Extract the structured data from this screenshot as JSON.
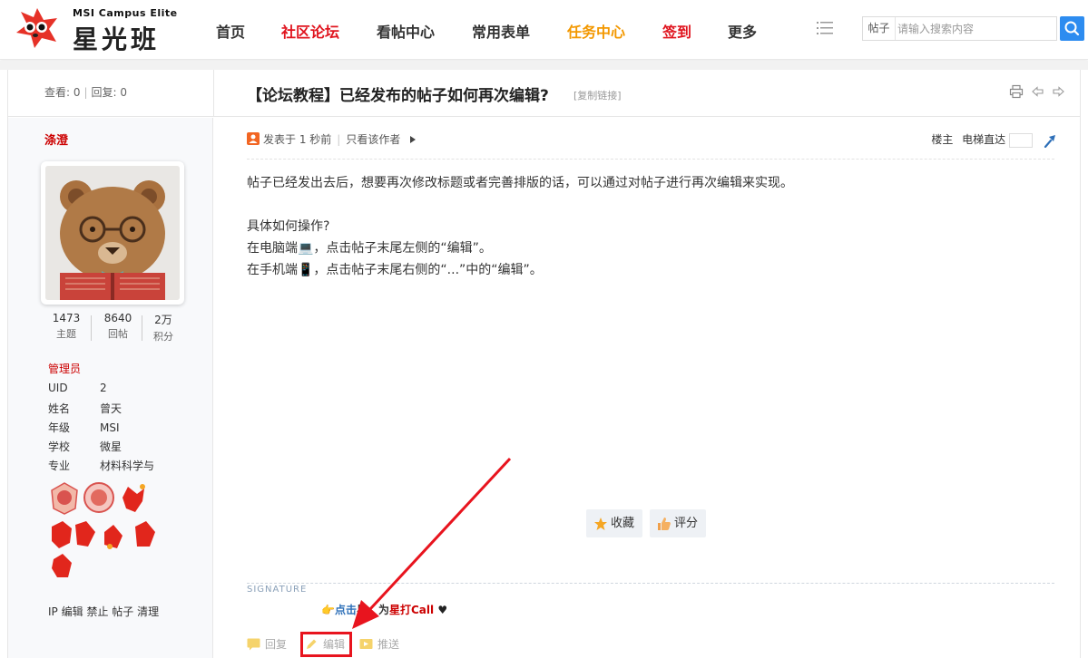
{
  "logo": {
    "small_text": "MSI Campus Elite",
    "big_text": "星光班"
  },
  "nav": {
    "items": [
      {
        "label": "首页",
        "color": "#333333"
      },
      {
        "label": "社区论坛",
        "color": "#e0141e"
      },
      {
        "label": "看帖中心",
        "color": "#333333"
      },
      {
        "label": "常用表单",
        "color": "#333333"
      },
      {
        "label": "任务中心",
        "color": "#f39800"
      },
      {
        "label": "签到",
        "color": "#e0141e"
      },
      {
        "label": "更多",
        "color": "#333333"
      }
    ]
  },
  "search": {
    "type_label": "帖子",
    "placeholder": "请输入搜索内容"
  },
  "thread": {
    "views_label": "查看: 0",
    "replies_label": "回复: 0",
    "title": "【论坛教程】已经发布的帖子如何再次编辑?",
    "copy_link": "[复制链接]"
  },
  "author": {
    "name": "涤澄",
    "stats": [
      {
        "value": "1473",
        "label": "主题"
      },
      {
        "value": "8640",
        "label": "回帖"
      },
      {
        "value": "2万",
        "label": "积分"
      }
    ],
    "role": "管理员",
    "info": [
      {
        "key": "UID",
        "value": "2"
      },
      {
        "key": "姓名",
        "value": "曾天"
      },
      {
        "key": "年级",
        "value": "MSI"
      },
      {
        "key": "学校",
        "value": "微星"
      },
      {
        "key": "专业",
        "value": "材料科学与"
      }
    ],
    "admin_links": [
      "IP",
      "编辑",
      "禁止",
      "帖子",
      "清理"
    ]
  },
  "post": {
    "posted_time": "发表于 1 秒前",
    "only_author": "只看该作者",
    "floor": "楼主",
    "elevator": "电梯直达",
    "body": [
      "帖子已经发出去后，想要再次修改标题或者完善排版的话，可以通过对帖子进行再次编辑来实现。",
      "",
      "具体如何操作?",
      "在电脑端💻，点击帖子末尾左侧的“编辑”。",
      "在手机端📱，点击帖子末尾右侧的“...”中的“编辑”。"
    ],
    "favorite_label": "收藏",
    "rate_label": "评分",
    "signature_label": "SIGNATURE",
    "signature_prefix": "点击",
    "signature_mid": "星，为",
    "signature_star": "星打",
    "signature_call": "Call",
    "reply_label": "回复",
    "edit_label": "编辑",
    "push_label": "推送"
  },
  "colors": {
    "accent_red": "#e0141e",
    "accent_blue": "#2d8cf0",
    "annotation_red": "#e8141e"
  }
}
